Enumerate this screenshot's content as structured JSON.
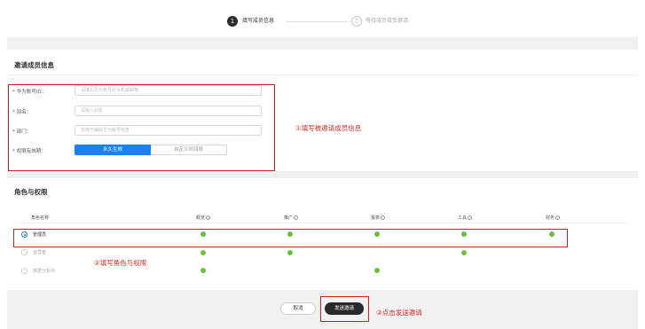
{
  "steps": [
    {
      "num": "1",
      "label": "填写成员信息",
      "active": true
    },
    {
      "num": "2",
      "label": "等待成员接受邀请",
      "active": false
    }
  ],
  "invite_section": {
    "title": "邀请成员信息",
    "fields": [
      {
        "label": "华为账号ID：",
        "placeholder": "请填写华为账号的手机或邮箱",
        "required": true
      },
      {
        "label": "别名：",
        "placeholder": "请输入别名",
        "required": true
      },
      {
        "label": "部门：",
        "placeholder": "仅用于辅助华为帐号检查",
        "required": true
      }
    ],
    "validity_label": "权限有效期：",
    "validity_options": [
      "永久生效",
      "自定义时间段"
    ],
    "validity_selected": "永久生效"
  },
  "annotations": {
    "step1": "①填写被邀请成员信息",
    "step2": "②填写角色与权限",
    "step3": "③点击发送邀请"
  },
  "roles_section": {
    "title": "角色与权限",
    "columns": [
      "角色名称",
      "概览",
      "推广",
      "报表",
      "工具",
      "财务"
    ],
    "rows": [
      {
        "name": "管理员",
        "selected": true,
        "perms": [
          true,
          true,
          true,
          true,
          true
        ]
      },
      {
        "name": "运营者",
        "selected": false,
        "perms": [
          true,
          true,
          false,
          true,
          false
        ]
      },
      {
        "name": "数据分析师",
        "selected": false,
        "perms": [
          true,
          false,
          true,
          false,
          false
        ]
      }
    ]
  },
  "footer": {
    "cancel_label": "取消",
    "send_label": "发送邀请"
  },
  "colors": {
    "accent": "#1e7ff0",
    "permission_dot": "#6bbf3a",
    "annotation_red": "#c82020",
    "primary_button": "#2a2a2a"
  },
  "icons": {
    "column_info": "info-circle-icon",
    "required_marker": "asterisk"
  }
}
